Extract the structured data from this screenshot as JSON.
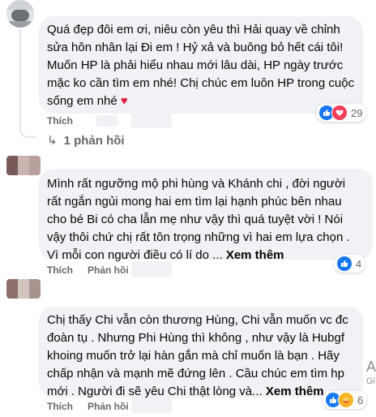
{
  "comments": [
    {
      "lines": [
        "Quá đẹp đôi em ơi, niêu còn yêu thì Hải quay về chỉnh",
        "sửa hôn nhân lại Đi em ! Hỷ xả và buông bỏ hết cái tôi!",
        "Muốn HP là phải hiểu nhau mới lâu dài, HP ngày trước",
        "mặc ko cần tìm em nhé! Chị chúc em luôn HP trong cuộc",
        "sống em nhé"
      ],
      "heart": "♥",
      "like_label": "Thích",
      "reaction_count": "29",
      "replies_label": "1 phản hồi"
    },
    {
      "lines": [
        "Mình rất ngưỡng mộ phi hùng và Khánh chi , đời người",
        "rất ngắn ngủi mong hai em tìm lại hạnh phúc bên nhau",
        "cho bé Bi có cha lẫn mẹ như vậy thì quá tuyệt vời ! Nói",
        "vậy thôi chứ chị rất tôn trọng những vì hai em lựa chọn .",
        "Vì mỗi con người điều có lí do ..."
      ],
      "see_more": "Xem thêm",
      "like_label": "Thích",
      "reply_label": "Phản hồi",
      "reaction_count": "4"
    },
    {
      "lines": [
        "Chị thấy Chi vẫn còn thương Hùng, Chi vẫn muốn vc đc",
        "đoàn tụ . Nhưng Phi Hùng thì không , như vậy là Hubgf",
        "khoing muốn trở lại hàn gắn mà chỉ muốn là bạn . Hãy",
        "chấp nhận và mạnh mẽ đứng lên . Cầu chúc em tìm hp",
        "mới . Người đi sẽ yêu Chi thật lòng và..."
      ],
      "see_more": "Xem thêm",
      "like_label": "Thích",
      "reply_label": "Phản hồi",
      "reaction_count": "6"
    }
  ],
  "side": {
    "letter": "A",
    "small": "Gi"
  },
  "colors": {
    "bubble": "#f0f2f5",
    "meta": "#65676b",
    "like": "#1877f2",
    "love": "#f33e58",
    "care": "#f7b125"
  }
}
